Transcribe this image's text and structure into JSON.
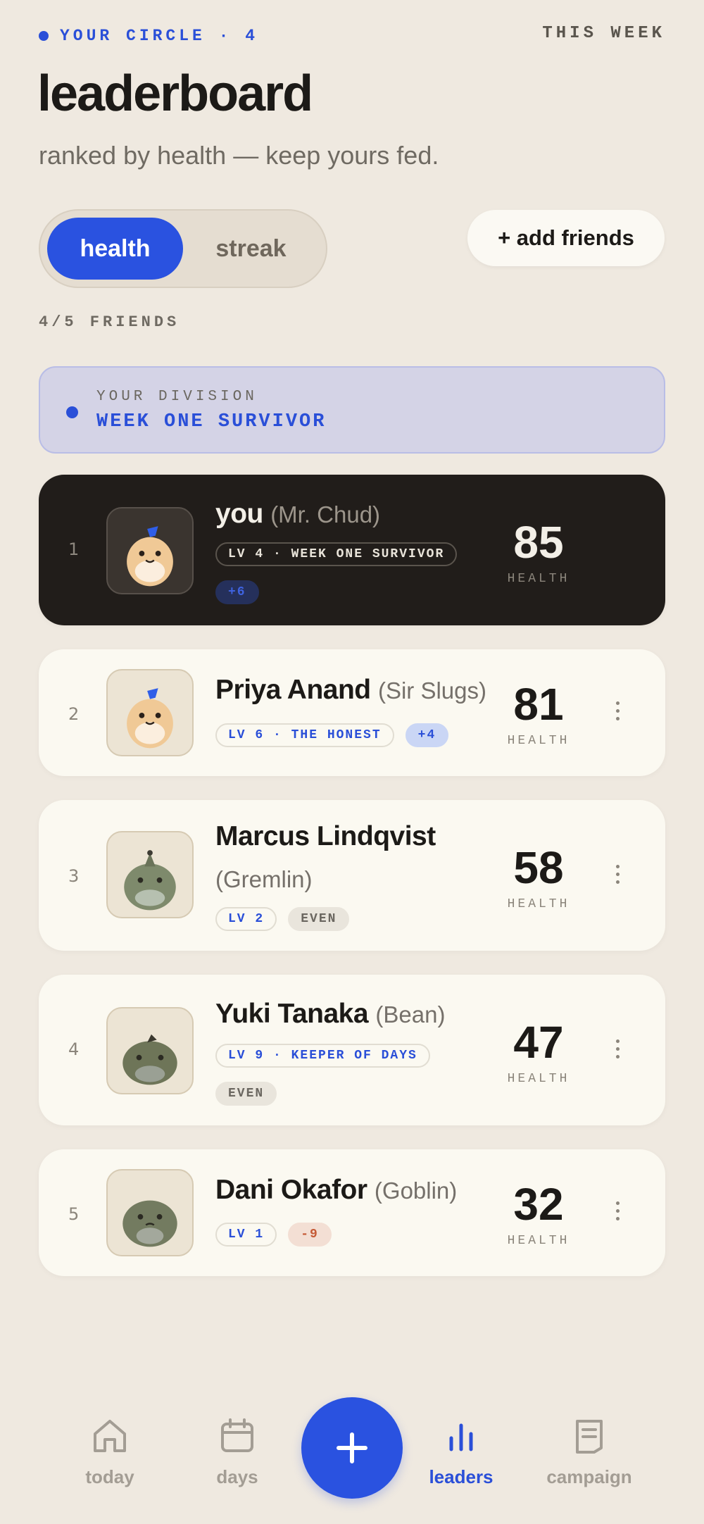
{
  "header": {
    "circle_label": "YOUR CIRCLE · 4",
    "period_label": "THIS WEEK",
    "title": "leaderboard",
    "subtitle": "ranked by health — keep yours fed."
  },
  "tabs": [
    {
      "label": "health",
      "active": true
    },
    {
      "label": "streak",
      "active": false
    }
  ],
  "add_friends_label": "+ add friends",
  "friends_count": "4/5 FRIENDS",
  "division": {
    "caption": "YOUR DIVISION",
    "name": "WEEK ONE SURVIVOR"
  },
  "score_label": "HEALTH",
  "entries": [
    {
      "rank": "1",
      "name": "you",
      "nickname": "(Mr. Chud)",
      "tags": [
        "LV 4 · WEEK ONE SURVIVOR",
        "+6"
      ],
      "score": "85",
      "is_me": true,
      "avatar": "cream-blob-icon"
    },
    {
      "rank": "2",
      "name": "Priya Anand",
      "nickname": "(Sir Slugs)",
      "tags": [
        "LV 6 · THE HONEST",
        "+4"
      ],
      "score": "81",
      "avatar": "cream-blob-icon"
    },
    {
      "rank": "3",
      "name": "Marcus Lindqvist",
      "nickname": "(Gremlin)",
      "tags": [
        "LV 2",
        "EVEN"
      ],
      "score": "58",
      "avatar": "green-blob-icon"
    },
    {
      "rank": "4",
      "name": "Yuki Tanaka",
      "nickname": "(Bean)",
      "tags": [
        "LV 9 · KEEPER OF DAYS",
        "EVEN"
      ],
      "score": "47",
      "avatar": "green-blob-icon"
    },
    {
      "rank": "5",
      "name": "Dani Okafor",
      "nickname": "(Goblin)",
      "tags": [
        "LV 1",
        "-9"
      ],
      "score": "32",
      "avatar": "green-blob-icon"
    }
  ],
  "nav": [
    {
      "label": "today",
      "icon": "home-icon"
    },
    {
      "label": "days",
      "icon": "calendar-icon"
    },
    {
      "label": "leaders",
      "icon": "bar-chart-icon",
      "active": true
    },
    {
      "label": "campaign",
      "icon": "document-icon"
    }
  ],
  "colors": {
    "accent": "#2a52e0",
    "background": "#efe9e0",
    "card": "#fbf9f1",
    "me_card": "#211d1a"
  }
}
